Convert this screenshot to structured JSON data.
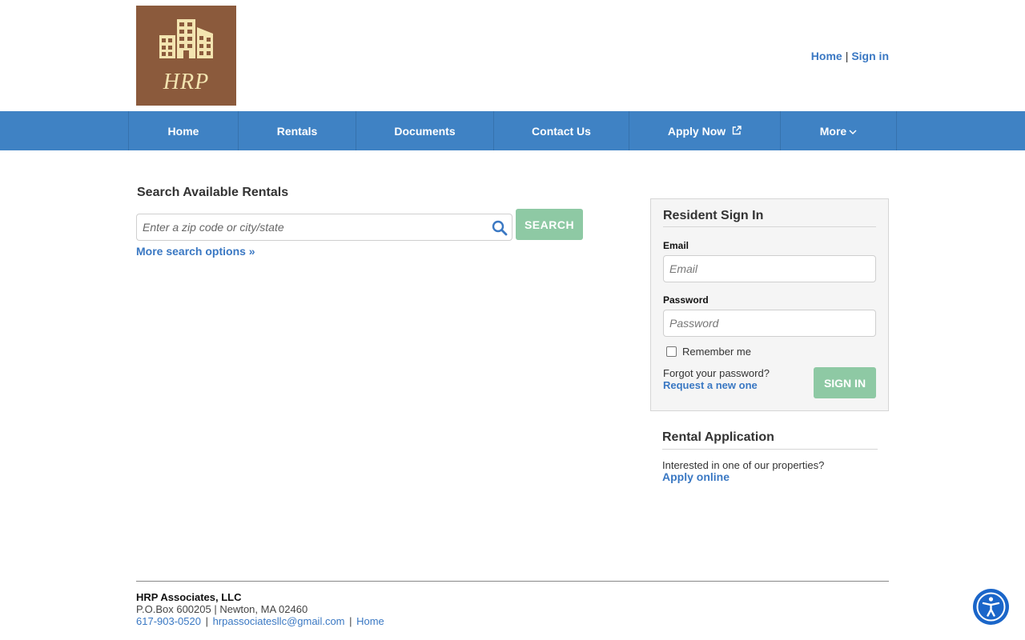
{
  "header": {
    "logo_text": "HRP",
    "top_links": [
      {
        "label": "Home"
      },
      {
        "label": "Sign in"
      }
    ]
  },
  "nav": {
    "items": [
      {
        "label": "Home"
      },
      {
        "label": "Rentals"
      },
      {
        "label": "Documents"
      },
      {
        "label": "Contact Us"
      },
      {
        "label": "Apply Now",
        "icon": "external-link-icon"
      },
      {
        "label": "More",
        "icon": "chevron-down-icon"
      }
    ]
  },
  "search": {
    "title": "Search Available Rentals",
    "placeholder": "Enter a zip code or city/state",
    "button_label": "SEARCH",
    "more_options": "More search options »"
  },
  "signin": {
    "title": "Resident Sign In",
    "email_label": "Email",
    "email_placeholder": "Email",
    "password_label": "Password",
    "password_placeholder": "Password",
    "remember_label": "Remember me",
    "forgot_text": "Forgot your password?",
    "request_link": "Request a new one",
    "button_label": "SIGN IN"
  },
  "rental_application": {
    "title": "Rental Application",
    "text": "Interested in one of our properties?",
    "link": "Apply online"
  },
  "footer": {
    "company": "HRP Associates, LLC",
    "address": "P.O.Box 600205 | Newton, MA 02460",
    "phone": "617-903-0520",
    "email": "hrpassociatesllc@gmail.com",
    "home": "Home"
  },
  "colors": {
    "nav_bg": "#3f82c4",
    "link": "#3a78c3",
    "button": "#8ec9a4",
    "logo_bg": "#8b5a3c"
  }
}
